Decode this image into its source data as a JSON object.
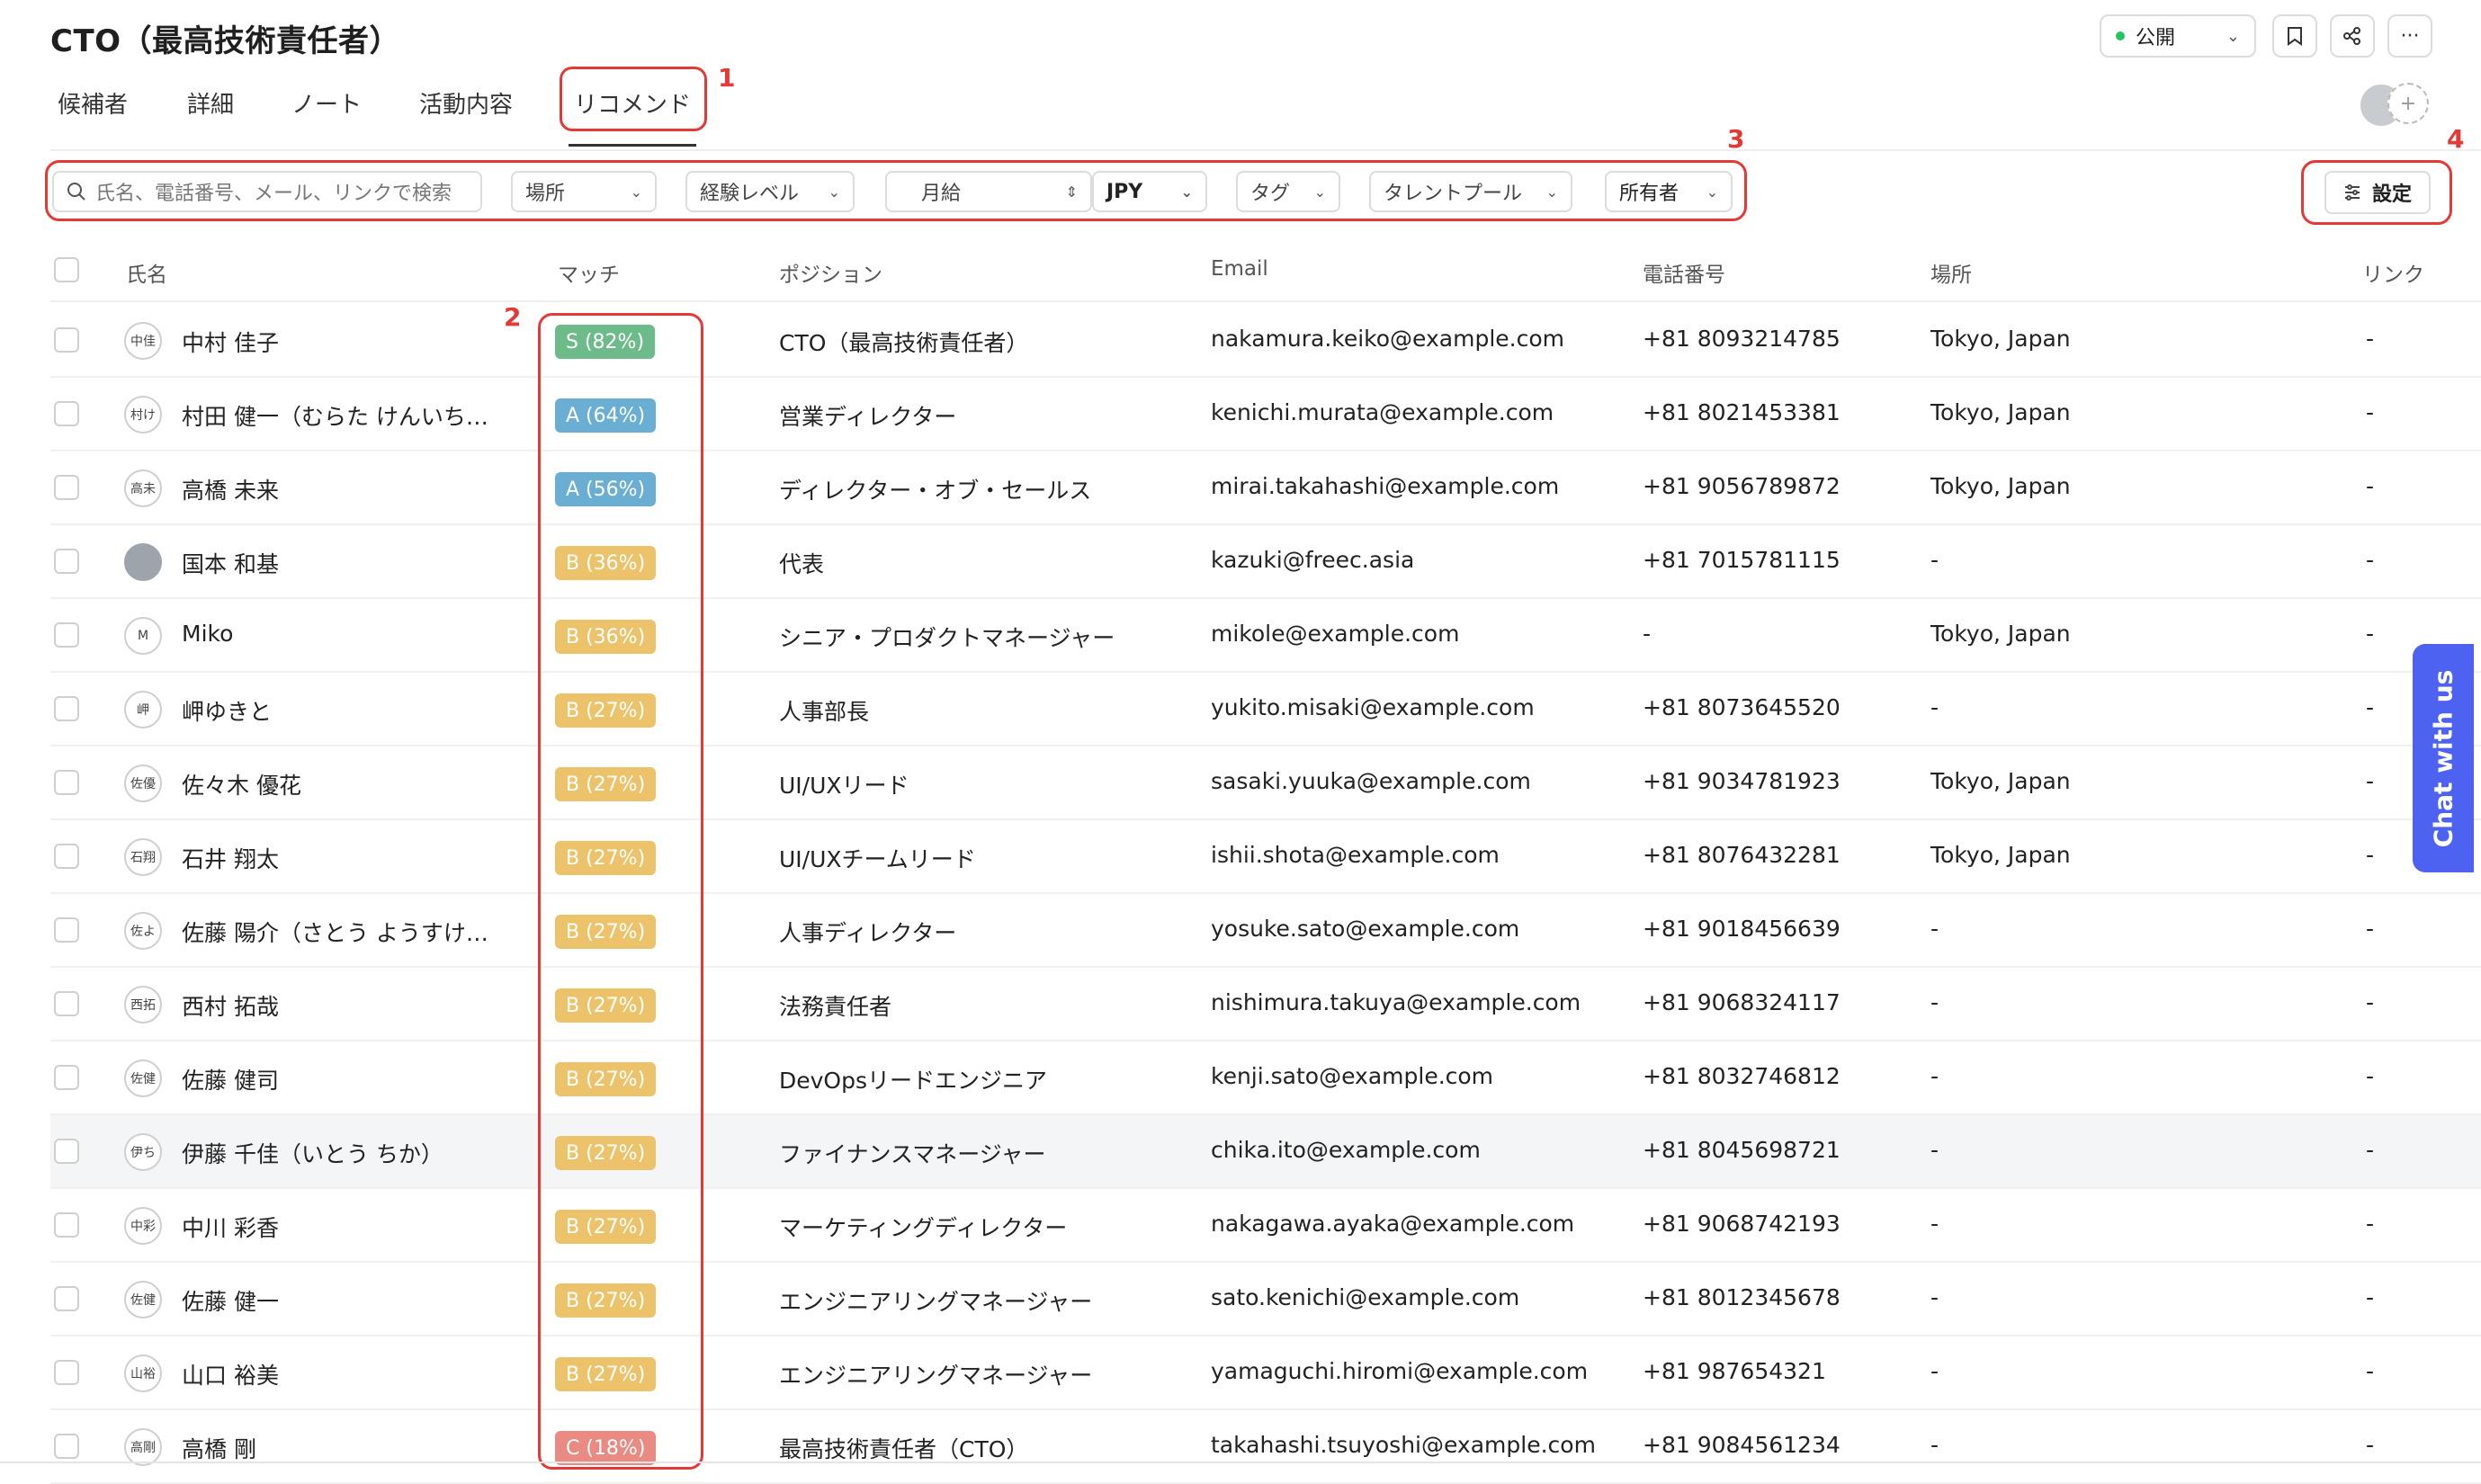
{
  "header": {
    "title": "CTO（最高技術責任者）",
    "visibility": "公開",
    "icons": [
      "bookmark-icon",
      "share-icon",
      "more-icon"
    ]
  },
  "tabs": [
    {
      "label": "候補者"
    },
    {
      "label": "詳細"
    },
    {
      "label": "ノート"
    },
    {
      "label": "活動内容"
    },
    {
      "label": "リコメンド",
      "active": true
    }
  ],
  "annotations": [
    "1",
    "2",
    "3",
    "4"
  ],
  "filters": {
    "search_placeholder": "氏名、電話番号、メール、リンクで検索",
    "location": "場所",
    "experience": "経験レベル",
    "salary_period": "月給",
    "currency": "JPY",
    "tag": "タグ",
    "talent_pool": "タレントプール",
    "owner": "所有者",
    "settings": "設定"
  },
  "table": {
    "columns": [
      "氏名",
      "マッチ",
      "ポジション",
      "Email",
      "電話番号",
      "場所",
      "リンク"
    ],
    "rows": [
      {
        "initials": "中佳",
        "name": "中村 佳子",
        "match": "S (82%)",
        "grade": "S",
        "position": "CTO（最高技術責任者）",
        "email": "nakamura.keiko@example.com",
        "phone": "+81 8093214785",
        "location": "Tokyo, Japan",
        "link": "-"
      },
      {
        "initials": "村け",
        "name": "村田 健一（むらた けんいち…",
        "match": "A (64%)",
        "grade": "A",
        "position": "営業ディレクター",
        "email": "kenichi.murata@example.com",
        "phone": "+81 8021453381",
        "location": "Tokyo, Japan",
        "link": "-"
      },
      {
        "initials": "高未",
        "name": "高橋 未来",
        "match": "A (56%)",
        "grade": "A",
        "position": "ディレクター・オブ・セールス",
        "email": "mirai.takahashi@example.com",
        "phone": "+81 9056789872",
        "location": "Tokyo, Japan",
        "link": "-"
      },
      {
        "initials": "",
        "photo": true,
        "name": "国本 和基",
        "match": "B (36%)",
        "grade": "B",
        "position": "代表",
        "email": "kazuki@freec.asia",
        "phone": "+81 7015781115",
        "location": "-",
        "link": "-"
      },
      {
        "initials": "M",
        "name": "Miko",
        "match": "B (36%)",
        "grade": "B",
        "position": "シニア・プロダクトマネージャー",
        "email": "mikole@example.com",
        "phone": "-",
        "location": "Tokyo, Japan",
        "link": "-"
      },
      {
        "initials": "岬",
        "name": "岬ゆきと",
        "match": "B (27%)",
        "grade": "B",
        "position": "人事部長",
        "email": "yukito.misaki@example.com",
        "phone": "+81 8073645520",
        "location": "-",
        "link": "-"
      },
      {
        "initials": "佐優",
        "name": "佐々木 優花",
        "match": "B (27%)",
        "grade": "B",
        "position": "UI/UXリード",
        "email": "sasaki.yuuka@example.com",
        "phone": "+81 9034781923",
        "location": "Tokyo, Japan",
        "link": "-"
      },
      {
        "initials": "石翔",
        "name": "石井 翔太",
        "match": "B (27%)",
        "grade": "B",
        "position": "UI/UXチームリード",
        "email": "ishii.shota@example.com",
        "phone": "+81 8076432281",
        "location": "Tokyo, Japan",
        "link": "-"
      },
      {
        "initials": "佐よ",
        "name": "佐藤 陽介（さとう ようすけ…",
        "match": "B (27%)",
        "grade": "B",
        "position": "人事ディレクター",
        "email": "yosuke.sato@example.com",
        "phone": "+81 9018456639",
        "location": "-",
        "link": "-"
      },
      {
        "initials": "西拓",
        "name": "西村 拓哉",
        "match": "B (27%)",
        "grade": "B",
        "position": "法務責任者",
        "email": "nishimura.takuya@example.com",
        "phone": "+81 9068324117",
        "location": "-",
        "link": "-"
      },
      {
        "initials": "佐健",
        "name": "佐藤 健司",
        "match": "B (27%)",
        "grade": "B",
        "position": "DevOpsリードエンジニア",
        "email": "kenji.sato@example.com",
        "phone": "+81 8032746812",
        "location": "-",
        "link": "-"
      },
      {
        "initials": "伊ち",
        "name": "伊藤 千佳（いとう ちか）",
        "match": "B (27%)",
        "grade": "B",
        "position": "ファイナンスマネージャー",
        "email": "chika.ito@example.com",
        "phone": "+81 8045698721",
        "location": "-",
        "link": "-",
        "highlight": true
      },
      {
        "initials": "中彩",
        "name": "中川 彩香",
        "match": "B (27%)",
        "grade": "B",
        "position": "マーケティングディレクター",
        "email": "nakagawa.ayaka@example.com",
        "phone": "+81 9068742193",
        "location": "-",
        "link": "-"
      },
      {
        "initials": "佐健",
        "name": "佐藤 健一",
        "match": "B (27%)",
        "grade": "B",
        "position": "エンジニアリングマネージャー",
        "email": "sato.kenichi@example.com",
        "phone": "+81 8012345678",
        "location": "-",
        "link": "-"
      },
      {
        "initials": "山裕",
        "name": "山口 裕美",
        "match": "B (27%)",
        "grade": "B",
        "position": "エンジニアリングマネージャー",
        "email": "yamaguchi.hiromi@example.com",
        "phone": "+81 987654321",
        "location": "-",
        "link": "-"
      },
      {
        "initials": "高剛",
        "name": "高橋 剛",
        "match": "C (18%)",
        "grade": "C",
        "position": "最高技術責任者（CTO）",
        "email": "takahashi.tsuyoshi@example.com",
        "phone": "+81 9084561234",
        "location": "-",
        "link": "-"
      }
    ]
  },
  "grade_colors": {
    "S": "#6dbb8a",
    "A": "#6aaed3",
    "B": "#ecc36a",
    "C": "#e98a83"
  },
  "chat": {
    "label": "Chat with us"
  }
}
